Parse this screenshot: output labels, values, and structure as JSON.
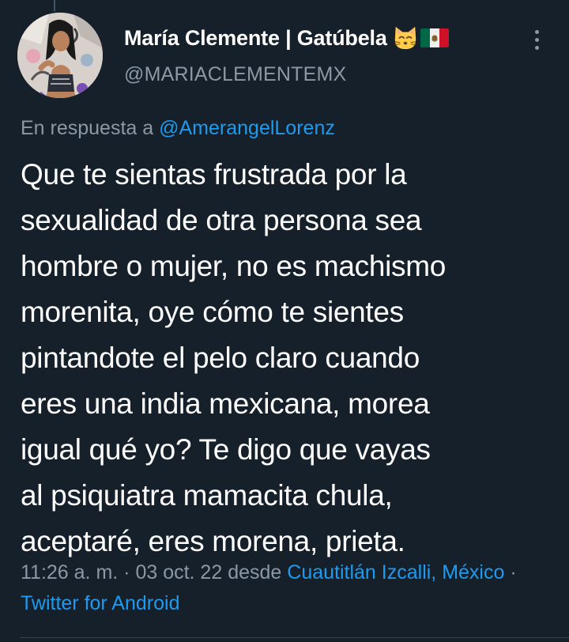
{
  "tweet": {
    "author": {
      "display_name": "María Clemente | Gatúbela",
      "handle": "@MARIACLEMENTEMX",
      "emoji": [
        "kissing-cat-emoji",
        "mexico-flag-emoji"
      ]
    },
    "reply": {
      "prefix": "En respuesta a",
      "mention": "@AmerangelLorenz"
    },
    "text": "Que te sientas frustrada por la\nsexualidad de otra persona sea\nhombre o mujer, no es machismo\nmorenita, oye cómo te sientes\npintandote el pelo claro cuando\neres una india mexicana, morea\nigual qué yo? Te digo que vayas\nal psiquiatra mamacita chula,\naceptaré, eres morena, prieta.",
    "meta": {
      "time": "11:26 a. m.",
      "separator": " · ",
      "date": "03 oct. 22",
      "location_prefix": " desde ",
      "location": "Cuautitlán Izcalli, México",
      "source": "Twitter for Android"
    }
  },
  "colors": {
    "background": "#15202b",
    "primary_text": "#ffffff",
    "secondary_text": "#8b98a5",
    "link": "#1d9bf0",
    "divider": "#38444d"
  },
  "icons": {
    "more": "more-vertical-icon"
  }
}
